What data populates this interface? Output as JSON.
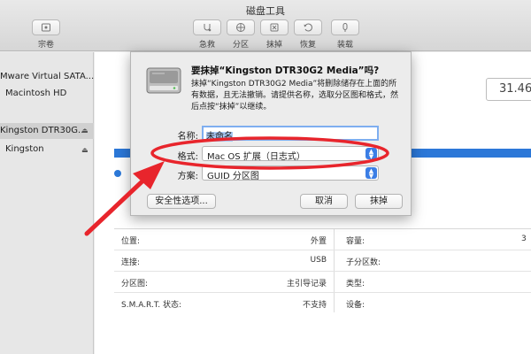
{
  "window": {
    "title": "磁盘工具"
  },
  "toolbar": {
    "buttons": [
      {
        "label": "宗卷"
      },
      {
        "label": "急救"
      },
      {
        "label": "分区"
      },
      {
        "label": "抹掉"
      },
      {
        "label": "恢复"
      },
      {
        "label": "装载"
      }
    ]
  },
  "sidebar": {
    "items": [
      {
        "label": "Mware Virtual SATA..."
      },
      {
        "label": "Macintosh HD"
      },
      {
        "label": "Kingston DTR30G..."
      },
      {
        "label": "Kingston"
      }
    ],
    "eject_symbol": "⏏"
  },
  "main": {
    "capacity": "31.46",
    "info": {
      "left": [
        {
          "label": "位置:",
          "value": "外置"
        },
        {
          "label": "连接:",
          "value": "USB"
        },
        {
          "label": "分区图:",
          "value": "主引导记录"
        },
        {
          "label": "S.M.A.R.T. 状态:",
          "value": "不支持"
        }
      ],
      "right": [
        {
          "label": "容量:",
          "value": "3"
        },
        {
          "label": "子分区数:",
          "value": ""
        },
        {
          "label": "类型:",
          "value": ""
        },
        {
          "label": "设备:",
          "value": ""
        }
      ]
    }
  },
  "dialog": {
    "title": "要抹掉“Kingston DTR30G2 Media”吗?",
    "description": "抹掉“Kingston DTR30G2 Media”将删除储存在上面的所有数据，且无法撤销。请提供名称，选取分区图和格式，然后点按“抹掉”以继续。",
    "name_label": "名称:",
    "name_value": "未命名",
    "format_label": "格式:",
    "format_value": "Mac OS 扩展（日志式）",
    "scheme_label": "方案:",
    "scheme_value": "GUID 分区图",
    "security_button": "安全性选项...",
    "cancel_button": "取消",
    "erase_button": "抹掉"
  },
  "colors": {
    "accent": "#2c78d8",
    "annotation": "#e8252c"
  }
}
